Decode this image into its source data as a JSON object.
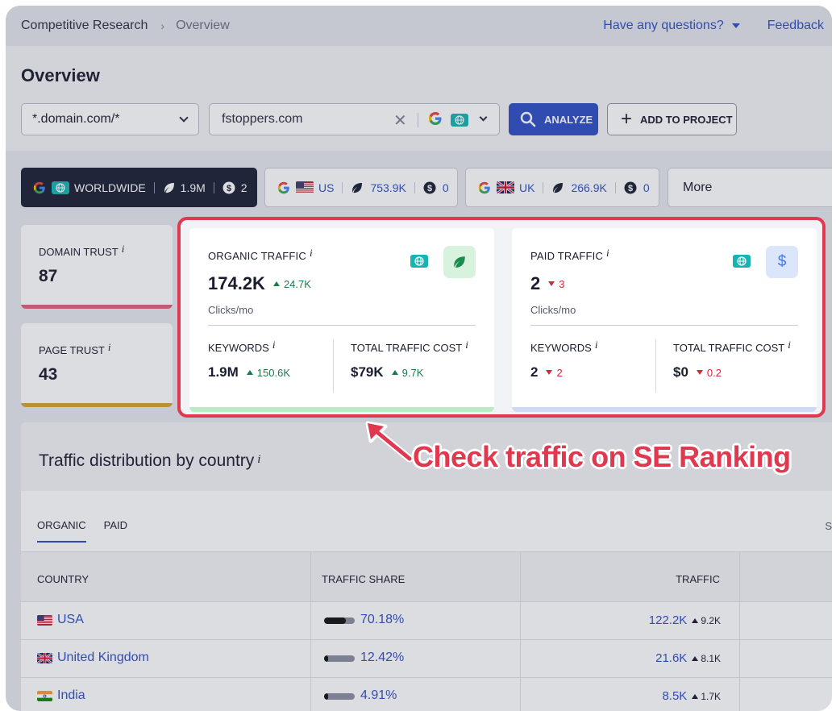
{
  "breadcrumb": {
    "parent": "Competitive Research",
    "separator": "›",
    "current": "Overview"
  },
  "top_links": {
    "questions": "Have any questions?",
    "feedback": "Feedback"
  },
  "page_title": "Overview",
  "search": {
    "scope_value": "*.domain.com/*",
    "domain_value": "fstoppers.com",
    "analyze_label": "ANALYZE",
    "add_project_label": "ADD TO PROJECT"
  },
  "regions": [
    {
      "name": "WORLDWIDE",
      "organic": "1.9M",
      "paid": "2",
      "active": true
    },
    {
      "name": "US",
      "organic": "753.9K",
      "paid": "0",
      "active": false
    },
    {
      "name": "UK",
      "organic": "266.9K",
      "paid": "0",
      "active": false
    }
  ],
  "more_label": "More",
  "domain_trust": {
    "label": "DOMAIN TRUST",
    "value": "87"
  },
  "page_trust": {
    "label": "PAGE TRUST",
    "value": "43"
  },
  "organic": {
    "label": "ORGANIC TRAFFIC",
    "value": "174.2K",
    "delta": "24.7K",
    "unit": "Clicks/mo",
    "keywords_label": "KEYWORDS",
    "keywords_value": "1.9M",
    "keywords_delta": "150.6K",
    "cost_label": "TOTAL TRAFFIC COST",
    "cost_value": "$79K",
    "cost_delta": "9.7K"
  },
  "paid": {
    "label": "PAID TRAFFIC",
    "value": "2",
    "delta": "3",
    "unit": "Clicks/mo",
    "keywords_label": "KEYWORDS",
    "keywords_value": "2",
    "keywords_delta": "2",
    "cost_label": "TOTAL TRAFFIC COST",
    "cost_value": "$0",
    "cost_delta": "0.2",
    "icon_glyph": "$"
  },
  "distribution": {
    "title": "Traffic distribution by country",
    "tabs": [
      "ORGANIC",
      "PAID"
    ],
    "right_fragment": "S",
    "columns": [
      "COUNTRY",
      "TRAFFIC SHARE",
      "TRAFFIC"
    ],
    "rows": [
      {
        "country": "USA",
        "share": "70.18%",
        "share_fraction": 0.7018,
        "traffic": "122.2K",
        "delta": "9.2K"
      },
      {
        "country": "United Kingdom",
        "share": "12.42%",
        "share_fraction": 0.1242,
        "traffic": "21.6K",
        "delta": "8.1K"
      },
      {
        "country": "India",
        "share": "4.91%",
        "share_fraction": 0.0491,
        "traffic": "8.5K",
        "delta": "1.7K"
      }
    ]
  },
  "annotation": "Check traffic on SE Ranking",
  "colors": {
    "accent": "#2f4fc4",
    "highlight": "#e0384e",
    "up": "#1d7a4a",
    "down": "#d0283c",
    "domain_trust_bar": "#e0607a",
    "page_trust_bar": "#d4a52a",
    "organic_bar": "#9fe0ac",
    "paid_bar": "#b9cdf5"
  },
  "icons": {
    "search_engine": "google-icon",
    "worldwide": "globe-icon",
    "organic": "leaf-icon",
    "paid": "dollar-icon"
  }
}
